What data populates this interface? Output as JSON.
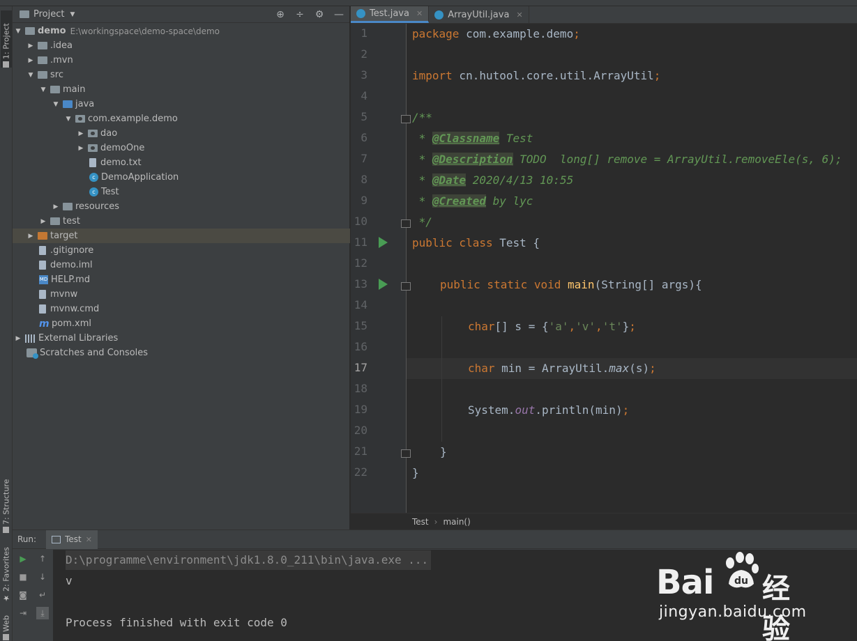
{
  "left_strip": {
    "project_tab": "1: Project",
    "structure_tab": "7: Structure",
    "favorites_tab": "2: Favorites",
    "web_tab": "Web"
  },
  "project": {
    "title": "Project",
    "tree": [
      {
        "label": "demo",
        "path": "E:\\workingspace\\demo-space\\demo"
      },
      {
        "label": ".idea"
      },
      {
        "label": ".mvn"
      },
      {
        "label": "src"
      },
      {
        "label": "main"
      },
      {
        "label": "java"
      },
      {
        "label": "com.example.demo"
      },
      {
        "label": "dao"
      },
      {
        "label": "demoOne"
      },
      {
        "label": "demo.txt"
      },
      {
        "label": "DemoApplication"
      },
      {
        "label": "Test"
      },
      {
        "label": "resources"
      },
      {
        "label": "test"
      },
      {
        "label": "target"
      },
      {
        "label": ".gitignore"
      },
      {
        "label": "demo.iml"
      },
      {
        "label": "HELP.md"
      },
      {
        "label": "mvnw"
      },
      {
        "label": "mvnw.cmd"
      },
      {
        "label": "pom.xml"
      },
      {
        "label": "External Libraries"
      },
      {
        "label": "Scratches and Consoles"
      }
    ]
  },
  "editor": {
    "tabs": [
      {
        "label": "Test.java"
      },
      {
        "label": "ArrayUtil.java"
      }
    ],
    "line_numbers": [
      "1",
      "2",
      "3",
      "4",
      "5",
      "6",
      "7",
      "8",
      "9",
      "10",
      "11",
      "12",
      "13",
      "14",
      "15",
      "16",
      "17",
      "18",
      "19",
      "20",
      "21",
      "22"
    ],
    "current_line": 17,
    "code": {
      "l1_kw": "package",
      "l1_rest": " com.example.demo",
      "l1_semi": ";",
      "l3_kw": "import",
      "l3_rest": " cn.hutool.core.util.ArrayUtil",
      "l3_semi": ";",
      "l5": "/**",
      "l6_star": " * ",
      "l6_tag": "@Classname",
      "l6_text": " Test",
      "l7_star": " * ",
      "l7_tag": "@Description",
      "l7_text": " TODO  long[] remove = ArrayUtil.removeEle(s, 6);",
      "l8_star": " * ",
      "l8_tag": "@Date",
      "l8_text": " 2020/4/13 10:55",
      "l9_star": " * ",
      "l9_tag": "@Created",
      "l9_text": " by lyc",
      "l10": " */",
      "l11_kw": "public class",
      "l11_rest": " Test {",
      "l13_kw": "public static void",
      "l13_fn": "main",
      "l13_rest": "(String[] args){",
      "l15_kw": "char",
      "l15_a": "[] s = {",
      "l15_s1": "'a'",
      "l15_c1": ",",
      "l15_s2": "'v'",
      "l15_c2": ",",
      "l15_s3": "'t'",
      "l15_end": "}",
      "l15_semi": ";",
      "l17_kw": "char",
      "l17_a": " min = ArrayUtil.",
      "l17_m": "max",
      "l17_b": "(s)",
      "l17_semi": ";",
      "l19_a": "System.",
      "l19_out": "out",
      "l19_b": ".println(min)",
      "l19_semi": ";",
      "l21": "}",
      "l22": "}"
    },
    "breadcrumb": {
      "class": "Test",
      "method": "main()"
    }
  },
  "run": {
    "label": "Run:",
    "tab": "Test",
    "console": [
      "D:\\programme\\environment\\jdk1.8.0_211\\bin\\java.exe ...",
      "v",
      "",
      "Process finished with exit code 0"
    ]
  },
  "watermark": {
    "brand_a": "Bai",
    "brand_cn": "经验",
    "url": "jingyan.baidu.com"
  },
  "colors": {
    "keyword": "#cc7832",
    "doc": "#629755",
    "string": "#6a8759",
    "method": "#ffc66d",
    "static_field": "#9876aa",
    "accent": "#4a88c7",
    "run_green": "#499c54"
  }
}
